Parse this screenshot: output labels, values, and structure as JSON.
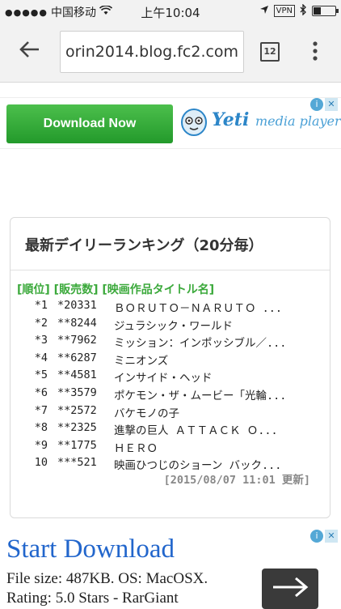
{
  "status_bar": {
    "signal_dots": "●●●●●",
    "carrier": "中国移动",
    "time": "上午10:04",
    "vpn": "VPN",
    "battery_level": 0.35
  },
  "toolbar": {
    "url": "orin2014.blog.fc2.com",
    "tab_count": "12"
  },
  "ad_top": {
    "button_label": "Download Now",
    "brand": "Yeti",
    "brand_sub": "media player"
  },
  "ranking": {
    "title": "最新デイリーランキング（20分毎）",
    "header": "[順位] [販売数] [映画作品タイトル名]",
    "rows": [
      {
        "rank": "*1",
        "sales": "*20331",
        "title": "ＢＯＲＵＴＯ－ＮＡＲＵＴＯ ..."
      },
      {
        "rank": "*2",
        "sales": "**8244",
        "title": "ジュラシック・ワールド"
      },
      {
        "rank": "*3",
        "sales": "**7962",
        "title": "ミッション：インポッシブル／..."
      },
      {
        "rank": "*4",
        "sales": "**6287",
        "title": "ミニオンズ"
      },
      {
        "rank": "*5",
        "sales": "**4581",
        "title": "インサイド・ヘッド"
      },
      {
        "rank": "*6",
        "sales": "**3579",
        "title": "ポケモン・ザ・ムービー「光輪..."
      },
      {
        "rank": "*7",
        "sales": "**2572",
        "title": "バケモノの子"
      },
      {
        "rank": "*8",
        "sales": "**2325",
        "title": "進撃の巨人 ＡＴＴＡＣＫ Ｏ..."
      },
      {
        "rank": "*9",
        "sales": "**1775",
        "title": "ＨＥＲＯ"
      },
      {
        "rank": "10",
        "sales": "***521",
        "title": "映画ひつじのショーン バック..."
      }
    ],
    "updated": "[2015/08/07 11:01 更新]"
  },
  "ad_bottom": {
    "headline": "Start Download",
    "line1": "File size: 487KB. OS: MacOSX.",
    "line2": "Rating: 5.0 Stars - RarGiant"
  }
}
